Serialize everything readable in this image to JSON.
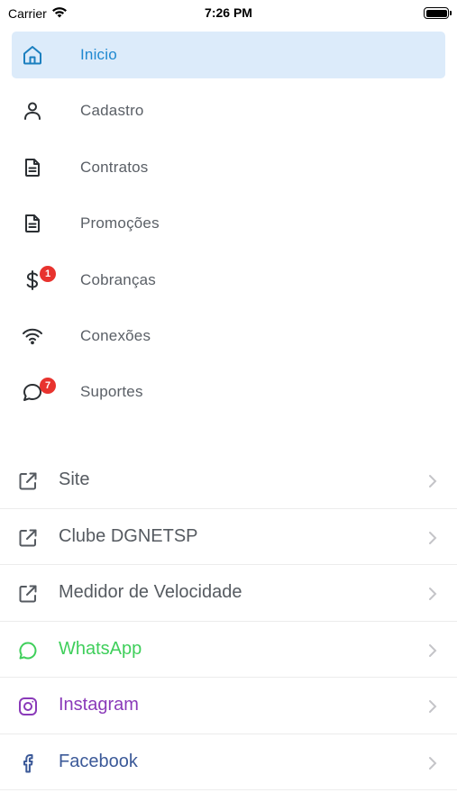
{
  "status_bar": {
    "carrier": "Carrier",
    "time": "7:26 PM"
  },
  "colors": {
    "active_bg": "#dcebfa",
    "active_text": "#1e88d0",
    "whatsapp": "#3fcf5b",
    "instagram": "#8a3ab9",
    "facebook": "#3b5998",
    "badge": "#e8332e"
  },
  "menu": {
    "items": [
      {
        "label": "Inicio",
        "icon": "home-icon",
        "active": true
      },
      {
        "label": "Cadastro",
        "icon": "person-icon"
      },
      {
        "label": "Contratos",
        "icon": "document-icon"
      },
      {
        "label": "Promoções",
        "icon": "document-icon"
      },
      {
        "label": "Cobranças",
        "icon": "dollar-icon",
        "badge": "1"
      },
      {
        "label": "Conexões",
        "icon": "wifi-icon"
      },
      {
        "label": "Suportes",
        "icon": "chat-bubble-icon",
        "badge": "7"
      }
    ]
  },
  "links": {
    "items": [
      {
        "label": "Site",
        "icon": "external-link-icon"
      },
      {
        "label": "Clube DGNETSP",
        "icon": "external-link-icon"
      },
      {
        "label": "Medidor de Velocidade",
        "icon": "external-link-icon"
      },
      {
        "label": "WhatsApp",
        "icon": "whatsapp-icon"
      },
      {
        "label": "Instagram",
        "icon": "instagram-icon"
      },
      {
        "label": "Facebook",
        "icon": "facebook-icon"
      }
    ]
  }
}
